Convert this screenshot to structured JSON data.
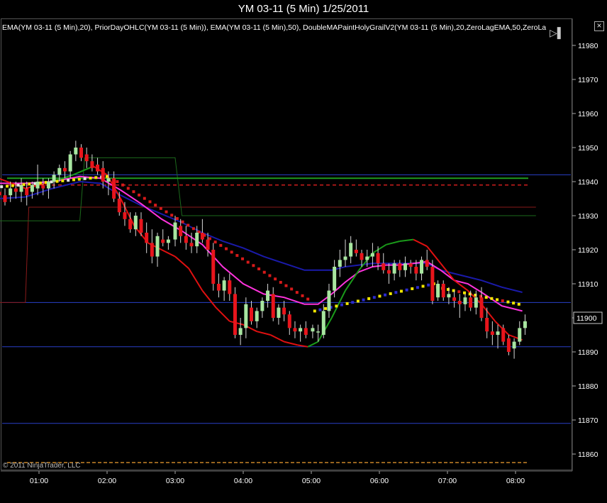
{
  "chart_title": "YM 03-11 (5 Min)  1/25/2011",
  "indicator_text": "EMA(YM 03-11 (5 Min),20), PriorDayOHLC(YM 03-11 (5 Min)), EMA(YM 03-11 (5 Min),50), DoubleMAPaintHolyGrailV2(YM 03-11 (5 Min),20,ZeroLagEMA,50,ZeroLa",
  "copyright": "© 2011 NinjaTrader, LLC",
  "icons": {
    "close": "close-icon",
    "scroll": "scroll-forward-icon"
  },
  "colors": {
    "background": "#000000",
    "up_candle": "#a8e6a0",
    "down_candle": "#e8151c",
    "ema20": "#ff33dd",
    "ema50": "#1a1aaa",
    "zerolag_red": "#e01010",
    "zerolag_green": "#1a9a1a",
    "prior_close": "#e02020",
    "prior_high": "#1f9a1f",
    "horizontal_lines": "#2a3fc8",
    "bottom_line": "#f0a030"
  },
  "chart_data": {
    "type": "candlestick",
    "title": "YM 03-11 (5 Min)  1/25/2011",
    "y_ticks": [
      11860,
      11870,
      11880,
      11890,
      11900,
      11910,
      11920,
      11930,
      11940,
      11950,
      11960,
      11970,
      11980
    ],
    "x_ticks": [
      "01:00",
      "02:00",
      "03:00",
      "04:00",
      "05:00",
      "06:00",
      "07:00",
      "08:00"
    ],
    "ylim": [
      11855,
      11984
    ],
    "last_price": 11900,
    "grid": false,
    "horizontal_lines": [
      11942,
      11904.5,
      11891.5,
      11869
    ],
    "dashed_lines": [
      {
        "name": "prior_close",
        "value": 11939
      },
      {
        "name": "bottom",
        "value": 11857.5
      }
    ],
    "prior_day_levels": {
      "dark_red_steps": [
        [
          0.4,
          11904.5
        ],
        [
          0.8,
          11904.5
        ],
        [
          0.85,
          11932.5
        ],
        [
          8.3,
          11932.5
        ]
      ],
      "dark_green_steps": [
        [
          0.4,
          11928.5
        ],
        [
          1.6,
          11928.5
        ],
        [
          1.67,
          11947
        ],
        [
          3.0,
          11947
        ],
        [
          3.1,
          11930
        ],
        [
          8.3,
          11930
        ]
      ]
    },
    "candles": [
      [
        0.42,
        11937,
        11939,
        11934,
        11936
      ],
      [
        0.5,
        11936,
        11938,
        11933,
        11934
      ],
      [
        0.58,
        11936,
        11940,
        11934,
        11938
      ],
      [
        0.66,
        11938,
        11940,
        11935,
        11937
      ],
      [
        0.74,
        11937,
        11941,
        11934,
        11939
      ],
      [
        0.82,
        11938,
        11940,
        11933,
        11936
      ],
      [
        0.9,
        11937,
        11940,
        11935,
        11939
      ],
      [
        0.98,
        11938,
        11945,
        11936,
        11940
      ],
      [
        1.06,
        11939,
        11941,
        11936,
        11938
      ],
      [
        1.14,
        11938,
        11941,
        11935,
        11940
      ],
      [
        1.22,
        11940,
        11943,
        11938,
        11942
      ],
      [
        1.3,
        11942,
        11945,
        11940,
        11944
      ],
      [
        1.38,
        11944,
        11946,
        11941,
        11943
      ],
      [
        1.46,
        11943,
        11949,
        11941,
        11948
      ],
      [
        1.54,
        11948,
        11952,
        11946,
        11950
      ],
      [
        1.62,
        11950,
        11951,
        11946,
        11947
      ],
      [
        1.7,
        11948,
        11950,
        11944,
        11946
      ],
      [
        1.78,
        11946,
        11948,
        11943,
        11944
      ],
      [
        1.86,
        11945,
        11947,
        11942,
        11943
      ],
      [
        1.94,
        11944,
        11946,
        11938,
        11940
      ],
      [
        2.02,
        11940,
        11943,
        11936,
        11941
      ],
      [
        2.1,
        11941,
        11943,
        11934,
        11935
      ],
      [
        2.18,
        11935,
        11937,
        11930,
        11931
      ],
      [
        2.26,
        11931,
        11934,
        11927,
        11929
      ],
      [
        2.34,
        11929,
        11931,
        11925,
        11926
      ],
      [
        2.42,
        11926,
        11931,
        11924,
        11930
      ],
      [
        2.5,
        11929,
        11931,
        11924,
        11925
      ],
      [
        2.58,
        11925,
        11928,
        11919,
        11922
      ],
      [
        2.66,
        11922,
        11926,
        11916,
        11918
      ],
      [
        2.74,
        11918,
        11925,
        11915,
        11924
      ],
      [
        2.82,
        11923,
        11926,
        11921,
        11922
      ],
      [
        2.9,
        11922,
        11924,
        11920,
        11923
      ],
      [
        3.0,
        11923,
        11930,
        11921,
        11928
      ],
      [
        3.08,
        11927,
        11929,
        11922,
        11924
      ],
      [
        3.16,
        11924,
        11927,
        11920,
        11922
      ],
      [
        3.24,
        11922,
        11925,
        11919,
        11921
      ],
      [
        3.32,
        11921,
        11927,
        11919,
        11925
      ],
      [
        3.4,
        11925,
        11929,
        11922,
        11923
      ],
      [
        3.48,
        11923,
        11925,
        11918,
        11920
      ],
      [
        3.56,
        11920,
        11922,
        11908,
        11910
      ],
      [
        3.64,
        11910,
        11913,
        11906,
        11908
      ],
      [
        3.72,
        11908,
        11912,
        11905,
        11911
      ],
      [
        3.8,
        11911,
        11913,
        11905,
        11907
      ],
      [
        3.88,
        11907,
        11909,
        11894,
        11895
      ],
      [
        3.96,
        11895,
        11900,
        11892,
        11897
      ],
      [
        4.04,
        11897,
        11906,
        11894,
        11904
      ],
      [
        4.12,
        11903,
        11905,
        11898,
        11899
      ],
      [
        4.2,
        11899,
        11903,
        11897,
        11902
      ],
      [
        4.28,
        11902,
        11906,
        11900,
        11905
      ],
      [
        4.36,
        11905,
        11910,
        11903,
        11908
      ],
      [
        4.44,
        11907,
        11909,
        11899,
        11900
      ],
      [
        4.52,
        11900,
        11904,
        11898,
        11903
      ],
      [
        4.6,
        11903,
        11905,
        11899,
        11901
      ],
      [
        4.68,
        11901,
        11902,
        11895,
        11897
      ],
      [
        4.76,
        11897,
        11899,
        11894,
        11896
      ],
      [
        4.84,
        11896,
        11898,
        11893,
        11897
      ],
      [
        4.92,
        11897,
        11899,
        11894,
        11895
      ],
      [
        5.02,
        11896,
        11898,
        11894,
        11897
      ],
      [
        5.1,
        11896,
        11898,
        11893,
        11896
      ],
      [
        5.18,
        11895,
        11904,
        11894,
        11902
      ],
      [
        5.26,
        11902,
        11910,
        11900,
        11908
      ],
      [
        5.34,
        11908,
        11917,
        11906,
        11915
      ],
      [
        5.42,
        11915,
        11920,
        11912,
        11917
      ],
      [
        5.5,
        11917,
        11923,
        11915,
        11918
      ],
      [
        5.58,
        11918,
        11924,
        11916,
        11922
      ],
      [
        5.66,
        11920,
        11923,
        11918,
        11919
      ],
      [
        5.74,
        11919,
        11920,
        11915,
        11917
      ],
      [
        5.82,
        11917,
        11920,
        11915,
        11918
      ],
      [
        5.9,
        11918,
        11922,
        11915,
        11919
      ],
      [
        5.98,
        11919,
        11921,
        11914,
        11916
      ],
      [
        6.06,
        11916,
        11919,
        11913,
        11914
      ],
      [
        6.14,
        11914,
        11916,
        11910,
        11913
      ],
      [
        6.22,
        11913,
        11917,
        11911,
        11916
      ],
      [
        6.3,
        11916,
        11917,
        11912,
        11914
      ],
      [
        6.38,
        11914,
        11918,
        11912,
        11916
      ],
      [
        6.46,
        11916,
        11917,
        11913,
        11915
      ],
      [
        6.54,
        11915,
        11917,
        11911,
        11913
      ],
      [
        6.62,
        11913,
        11918,
        11911,
        11917
      ],
      [
        6.7,
        11917,
        11920,
        11914,
        11915
      ],
      [
        6.78,
        11915,
        11917,
        11904,
        11905
      ],
      [
        6.86,
        11906,
        11911,
        11905,
        11910
      ],
      [
        6.94,
        11910,
        11911,
        11905,
        11906
      ],
      [
        7.02,
        11906,
        11909,
        11904,
        11907
      ],
      [
        7.1,
        11906,
        11908,
        11903,
        11905
      ],
      [
        7.18,
        11905,
        11907,
        11900,
        11904
      ],
      [
        7.26,
        11904,
        11907,
        11902,
        11906
      ],
      [
        7.34,
        11906,
        11908,
        11902,
        11903
      ],
      [
        7.42,
        11903,
        11908,
        11901,
        11906
      ],
      [
        7.5,
        11906,
        11909,
        11899,
        11900
      ],
      [
        7.58,
        11900,
        11903,
        11894,
        11896
      ],
      [
        7.66,
        11896,
        11899,
        11892,
        11895
      ],
      [
        7.74,
        11895,
        11898,
        11891,
        11896
      ],
      [
        7.82,
        11897,
        11898,
        11892,
        11893
      ],
      [
        7.9,
        11894,
        11895,
        11889,
        11890
      ],
      [
        7.98,
        11891,
        11894,
        11888,
        11893
      ],
      [
        8.06,
        11893,
        11899,
        11892,
        11897
      ],
      [
        8.14,
        11897,
        11901,
        11895,
        11899
      ]
    ],
    "ema20": [
      [
        0.4,
        11939.5
      ],
      [
        0.8,
        11939.5
      ],
      [
        1.2,
        11940
      ],
      [
        1.6,
        11941.5
      ],
      [
        1.9,
        11941
      ],
      [
        2.2,
        11937.5
      ],
      [
        2.5,
        11933.5
      ],
      [
        2.8,
        11929
      ],
      [
        3.1,
        11925.5
      ],
      [
        3.4,
        11921.5
      ],
      [
        3.7,
        11915
      ],
      [
        4.0,
        11910
      ],
      [
        4.3,
        11907
      ],
      [
        4.6,
        11906
      ],
      [
        4.9,
        11904
      ],
      [
        5.1,
        11904
      ],
      [
        5.3,
        11907
      ],
      [
        5.5,
        11910.5
      ],
      [
        5.7,
        11913.5
      ],
      [
        5.9,
        11915
      ],
      [
        6.1,
        11915.5
      ],
      [
        6.3,
        11915.5
      ],
      [
        6.5,
        11916
      ],
      [
        6.7,
        11916.5
      ],
      [
        6.9,
        11914
      ],
      [
        7.1,
        11911
      ],
      [
        7.3,
        11910
      ],
      [
        7.5,
        11907.5
      ],
      [
        7.8,
        11903.5
      ],
      [
        8.1,
        11902
      ]
    ],
    "ema50": [
      [
        0.4,
        11935
      ],
      [
        0.8,
        11935.5
      ],
      [
        1.2,
        11938
      ],
      [
        1.6,
        11940
      ],
      [
        1.9,
        11939.5
      ],
      [
        2.2,
        11936
      ],
      [
        2.5,
        11933
      ],
      [
        2.8,
        11930.5
      ],
      [
        3.1,
        11928
      ],
      [
        3.4,
        11925
      ],
      [
        3.7,
        11922.5
      ],
      [
        4.0,
        11920.5
      ],
      [
        4.3,
        11918
      ],
      [
        4.6,
        11916
      ],
      [
        4.9,
        11914
      ],
      [
        5.1,
        11914
      ],
      [
        5.3,
        11914
      ],
      [
        5.5,
        11915
      ],
      [
        5.7,
        11915.5
      ],
      [
        5.9,
        11916
      ],
      [
        6.1,
        11916
      ],
      [
        6.3,
        11916
      ],
      [
        6.5,
        11916
      ],
      [
        6.7,
        11916
      ],
      [
        6.9,
        11914
      ],
      [
        7.1,
        11913
      ],
      [
        7.3,
        11912
      ],
      [
        7.5,
        11911
      ],
      [
        7.8,
        11909
      ],
      [
        8.1,
        11907.5
      ]
    ],
    "zerolag50": [
      [
        0.4,
        11941
      ],
      [
        0.8,
        11938
      ],
      [
        1.2,
        11940
      ],
      [
        1.5,
        11942
      ],
      [
        1.8,
        11944.5
      ],
      [
        2.0,
        11942
      ],
      [
        2.2,
        11935
      ],
      [
        2.4,
        11927
      ],
      [
        2.6,
        11922
      ],
      [
        2.8,
        11920
      ],
      [
        3.0,
        11918
      ],
      [
        3.2,
        11914.5
      ],
      [
        3.4,
        11908
      ],
      [
        3.6,
        11903
      ],
      [
        3.8,
        11899
      ],
      [
        4.0,
        11898
      ],
      [
        4.2,
        11896
      ],
      [
        4.4,
        11895
      ],
      [
        4.6,
        11893
      ],
      [
        4.8,
        11892
      ],
      [
        4.95,
        11891.5
      ],
      [
        5.1,
        11893
      ],
      [
        5.3,
        11900
      ],
      [
        5.5,
        11908
      ],
      [
        5.7,
        11914
      ],
      [
        5.9,
        11919
      ],
      [
        6.1,
        11921.5
      ],
      [
        6.3,
        11922.5
      ],
      [
        6.5,
        11923
      ],
      [
        6.7,
        11921
      ],
      [
        6.9,
        11916
      ],
      [
        7.1,
        11911
      ],
      [
        7.3,
        11908
      ],
      [
        7.5,
        11904
      ],
      [
        7.7,
        11899
      ],
      [
        7.9,
        11895
      ],
      [
        8.1,
        11893.5
      ]
    ],
    "paint_bars": [
      {
        "x_start": 0.4,
        "x_end": 2.0,
        "value": 11938,
        "color": "yellow"
      },
      {
        "x_start": 2.05,
        "x_end": 5.0,
        "values_from": 11941,
        "values_to": 11905,
        "color": "red"
      },
      {
        "x_start": 5.05,
        "x_end": 6.8,
        "values_from": 11903,
        "values_to": 11910,
        "color": "mixed"
      },
      {
        "x_start": 6.85,
        "x_end": 8.1,
        "value": 11909,
        "color": "yellow"
      }
    ]
  }
}
